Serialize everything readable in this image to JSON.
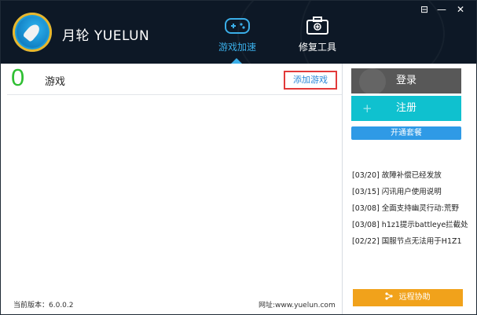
{
  "app": {
    "title": "月轮 YUELUN"
  },
  "tabs": [
    {
      "label": "游戏加速",
      "active": true,
      "icon": "gamepad-icon"
    },
    {
      "label": "修复工具",
      "active": false,
      "icon": "toolbox-icon"
    }
  ],
  "window_controls": {
    "menu": "⊟",
    "minimize": "—",
    "close": "✕"
  },
  "games": {
    "count": "0",
    "label": "游戏",
    "add_label": "添加游戏"
  },
  "account": {
    "login": "登录",
    "register": "注册",
    "plan": "开通套餐"
  },
  "news": [
    "[03/20] 故障补偿已经发放",
    "[03/15] 闪讯用户使用说明",
    "[03/08] 全面支持幽灵行动:荒野",
    "[03/08] h1z1提示battleye拦截处",
    "[02/22] 国服节点无法用于H1Z1"
  ],
  "footer": {
    "version": "当前版本：6.0.0.2",
    "site": "网址:www.yuelun.com"
  },
  "remote": {
    "label": "远程协助",
    "icon": "share-icon"
  },
  "colors": {
    "header": "#0d1826",
    "accent": "#3aaee8",
    "count": "#2fbf33",
    "register": "#0fc1cf",
    "remote": "#f1a21b"
  }
}
